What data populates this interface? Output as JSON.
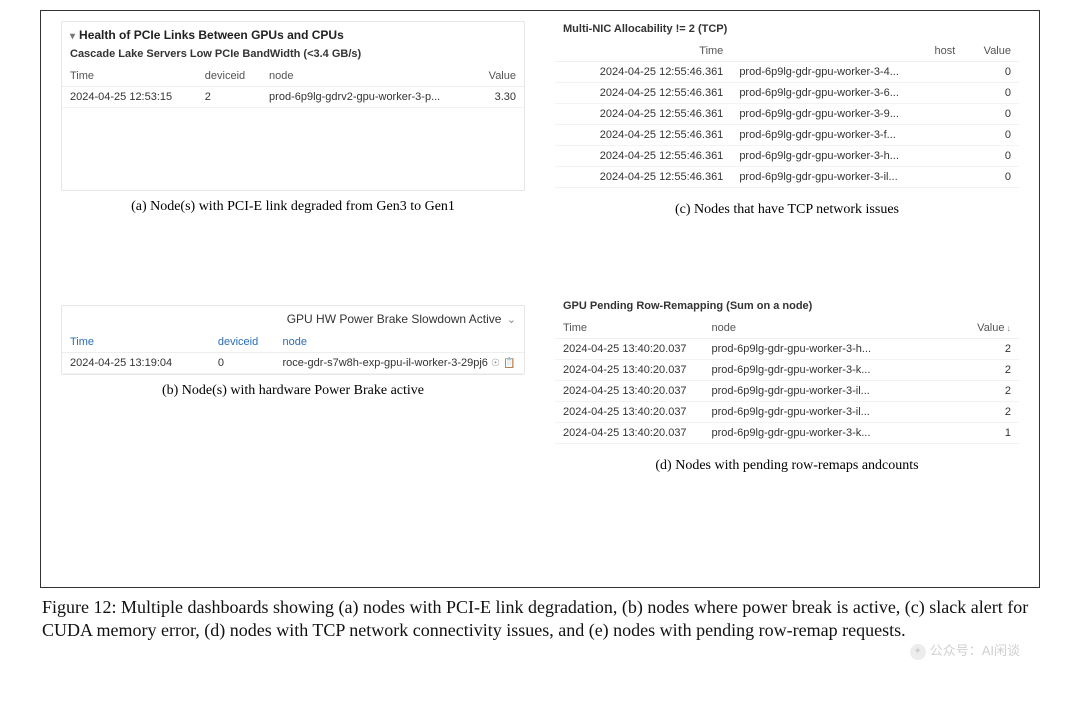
{
  "panelA": {
    "title": "Health of PCIe Links Between GPUs and CPUs",
    "subtitle": "Cascade Lake Servers Low PCIe BandWidth (<3.4 GB/s)",
    "headers": {
      "time": "Time",
      "deviceid": "deviceid",
      "node": "node",
      "value": "Value"
    },
    "row": {
      "time": "2024-04-25 12:53:15",
      "deviceid": "2",
      "node": "prod-6p9lg-gdrv2-gpu-worker-3-p...",
      "value": "3.30"
    }
  },
  "captionA": "(a) Node(s) with PCI-E link degraded from Gen3 to Gen1",
  "panelB": {
    "title": "GPU HW Power Brake Slowdown Active",
    "headers": {
      "time": "Time",
      "deviceid": "deviceid",
      "node": "node"
    },
    "row": {
      "time": "2024-04-25 13:19:04",
      "deviceid": "0",
      "node": "roce-gdr-s7w8h-exp-gpu-il-worker-3-29pj6"
    }
  },
  "captionB": "(b) Node(s) with hardware Power Brake active",
  "panelC": {
    "title": "Multi-NIC Allocability != 2 (TCP)",
    "headers": {
      "time": "Time",
      "host": "host",
      "value": "Value"
    },
    "rows": [
      {
        "time": "2024-04-25 12:55:46.361",
        "host": "prod-6p9lg-gdr-gpu-worker-3-4...",
        "value": "0"
      },
      {
        "time": "2024-04-25 12:55:46.361",
        "host": "prod-6p9lg-gdr-gpu-worker-3-6...",
        "value": "0"
      },
      {
        "time": "2024-04-25 12:55:46.361",
        "host": "prod-6p9lg-gdr-gpu-worker-3-9...",
        "value": "0"
      },
      {
        "time": "2024-04-25 12:55:46.361",
        "host": "prod-6p9lg-gdr-gpu-worker-3-f...",
        "value": "0"
      },
      {
        "time": "2024-04-25 12:55:46.361",
        "host": "prod-6p9lg-gdr-gpu-worker-3-h...",
        "value": "0"
      },
      {
        "time": "2024-04-25 12:55:46.361",
        "host": "prod-6p9lg-gdr-gpu-worker-3-il...",
        "value": "0"
      }
    ]
  },
  "captionC": "(c) Nodes that have TCP network issues",
  "panelD": {
    "title": "GPU Pending Row-Remapping (Sum on a node)",
    "headers": {
      "time": "Time",
      "node": "node",
      "value": "Value"
    },
    "rows": [
      {
        "time": "2024-04-25 13:40:20.037",
        "node": "prod-6p9lg-gdr-gpu-worker-3-h...",
        "value": "2"
      },
      {
        "time": "2024-04-25 13:40:20.037",
        "node": "prod-6p9lg-gdr-gpu-worker-3-k...",
        "value": "2"
      },
      {
        "time": "2024-04-25 13:40:20.037",
        "node": "prod-6p9lg-gdr-gpu-worker-3-il...",
        "value": "2"
      },
      {
        "time": "2024-04-25 13:40:20.037",
        "node": "prod-6p9lg-gdr-gpu-worker-3-il...",
        "value": "2"
      },
      {
        "time": "2024-04-25 13:40:20.037",
        "node": "prod-6p9lg-gdr-gpu-worker-3-k...",
        "value": "1"
      }
    ]
  },
  "captionD": "(d) Nodes with pending row-remaps andcounts",
  "figureCaption": "Figure 12: Multiple dashboards showing (a) nodes with PCI-E link degradation, (b) nodes where power break is active, (c) slack alert for CUDA memory error, (d) nodes with TCP network connectivity issues, and (e) nodes with pending row-remap requests.",
  "watermark": "公众号：AI闲谈"
}
